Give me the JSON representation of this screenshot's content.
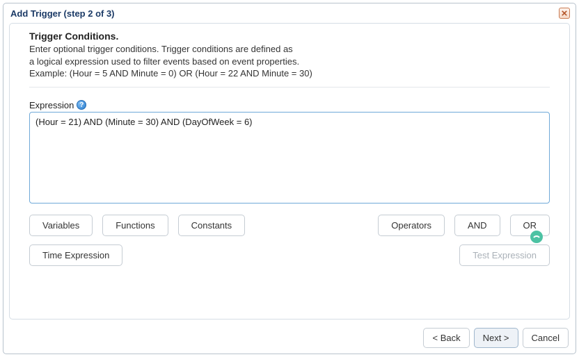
{
  "dialog": {
    "title": "Add Trigger (step 2 of 3)"
  },
  "heading": "Trigger Conditions.",
  "description": {
    "line1": "Enter optional trigger conditions. Trigger conditions are defined as",
    "line2": "a logical expression used to filter events based on event properties.",
    "line3": "Example: (Hour = 5 AND Minute = 0) OR (Hour = 22 AND Minute = 30)"
  },
  "expression": {
    "label": "Expression",
    "value": "(Hour = 21) AND (Minute = 30) AND (DayOfWeek = 6)"
  },
  "buttons": {
    "variables": "Variables",
    "functions": "Functions",
    "constants": "Constants",
    "operators": "Operators",
    "and": "AND",
    "or": "OR",
    "time_expression": "Time Expression",
    "test_expression": "Test Expression"
  },
  "footer": {
    "back": "< Back",
    "next": "Next >",
    "cancel": "Cancel"
  }
}
